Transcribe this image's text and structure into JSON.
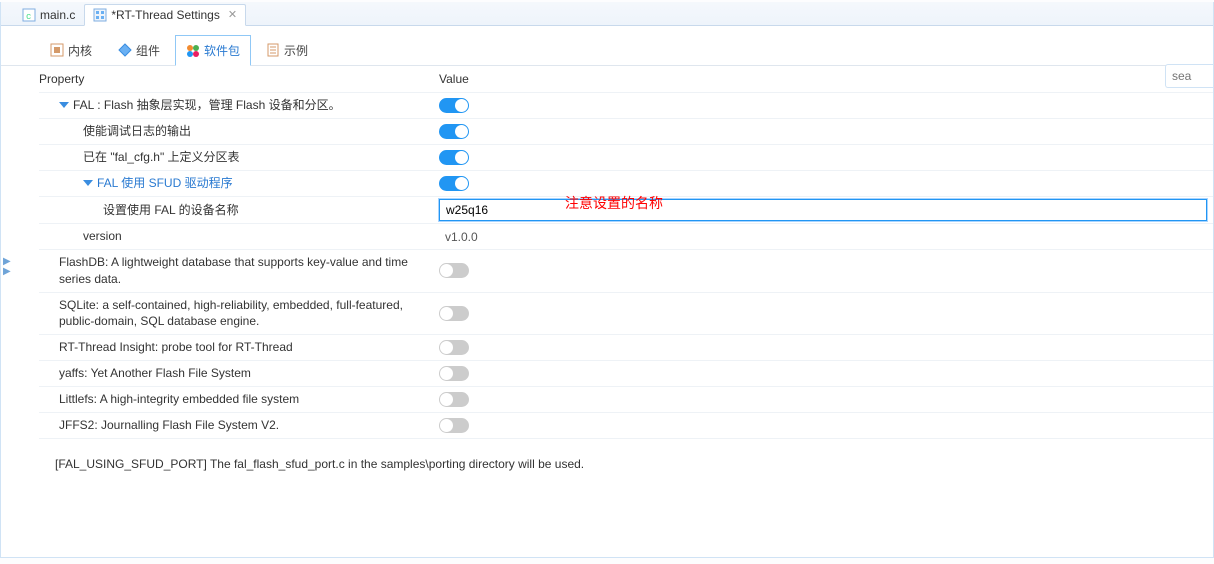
{
  "fileTabs": [
    {
      "label": "main.c",
      "active": false
    },
    {
      "label": "*RT-Thread Settings",
      "active": true
    }
  ],
  "innerTabs": [
    {
      "label": "内核"
    },
    {
      "label": "组件"
    },
    {
      "label": "软件包"
    },
    {
      "label": "示例"
    }
  ],
  "search": {
    "placeholder": "sea"
  },
  "headers": {
    "property": "Property",
    "value": "Value"
  },
  "rows": {
    "fal": {
      "label": "FAL : Flash 抽象层实现，管理 Flash 设备和分区。",
      "on": true
    },
    "debugLog": {
      "label": "使能调试日志的输出",
      "on": true
    },
    "cfgH": {
      "label": "已在 \"fal_cfg.h\" 上定义分区表",
      "on": true
    },
    "sfud": {
      "label": "FAL 使用 SFUD 驱动程序",
      "on": true
    },
    "devName": {
      "label": "设置使用 FAL 的设备名称",
      "value": "w25q16"
    },
    "version": {
      "label": "version",
      "value": "v1.0.0"
    },
    "flashdb": {
      "label": "FlashDB: A lightweight database that supports key-value and time series data.",
      "on": false
    },
    "sqlite": {
      "label": "SQLite: a self-contained, high-reliability, embedded, full-featured, public-domain, SQL database engine.",
      "on": false
    },
    "insight": {
      "label": "RT-Thread Insight: probe tool for RT-Thread",
      "on": false
    },
    "yaffs": {
      "label": "yaffs: Yet Another Flash File System",
      "on": false
    },
    "littlefs": {
      "label": "Littlefs: A high-integrity embedded file system",
      "on": false
    },
    "jffs2": {
      "label": "JFFS2: Journalling Flash File System V2.",
      "on": false
    }
  },
  "annotation": "注意设置的名称",
  "footer": "[FAL_USING_SFUD_PORT] The fal_flash_sfud_port.c in the samples\\porting directory will be used."
}
